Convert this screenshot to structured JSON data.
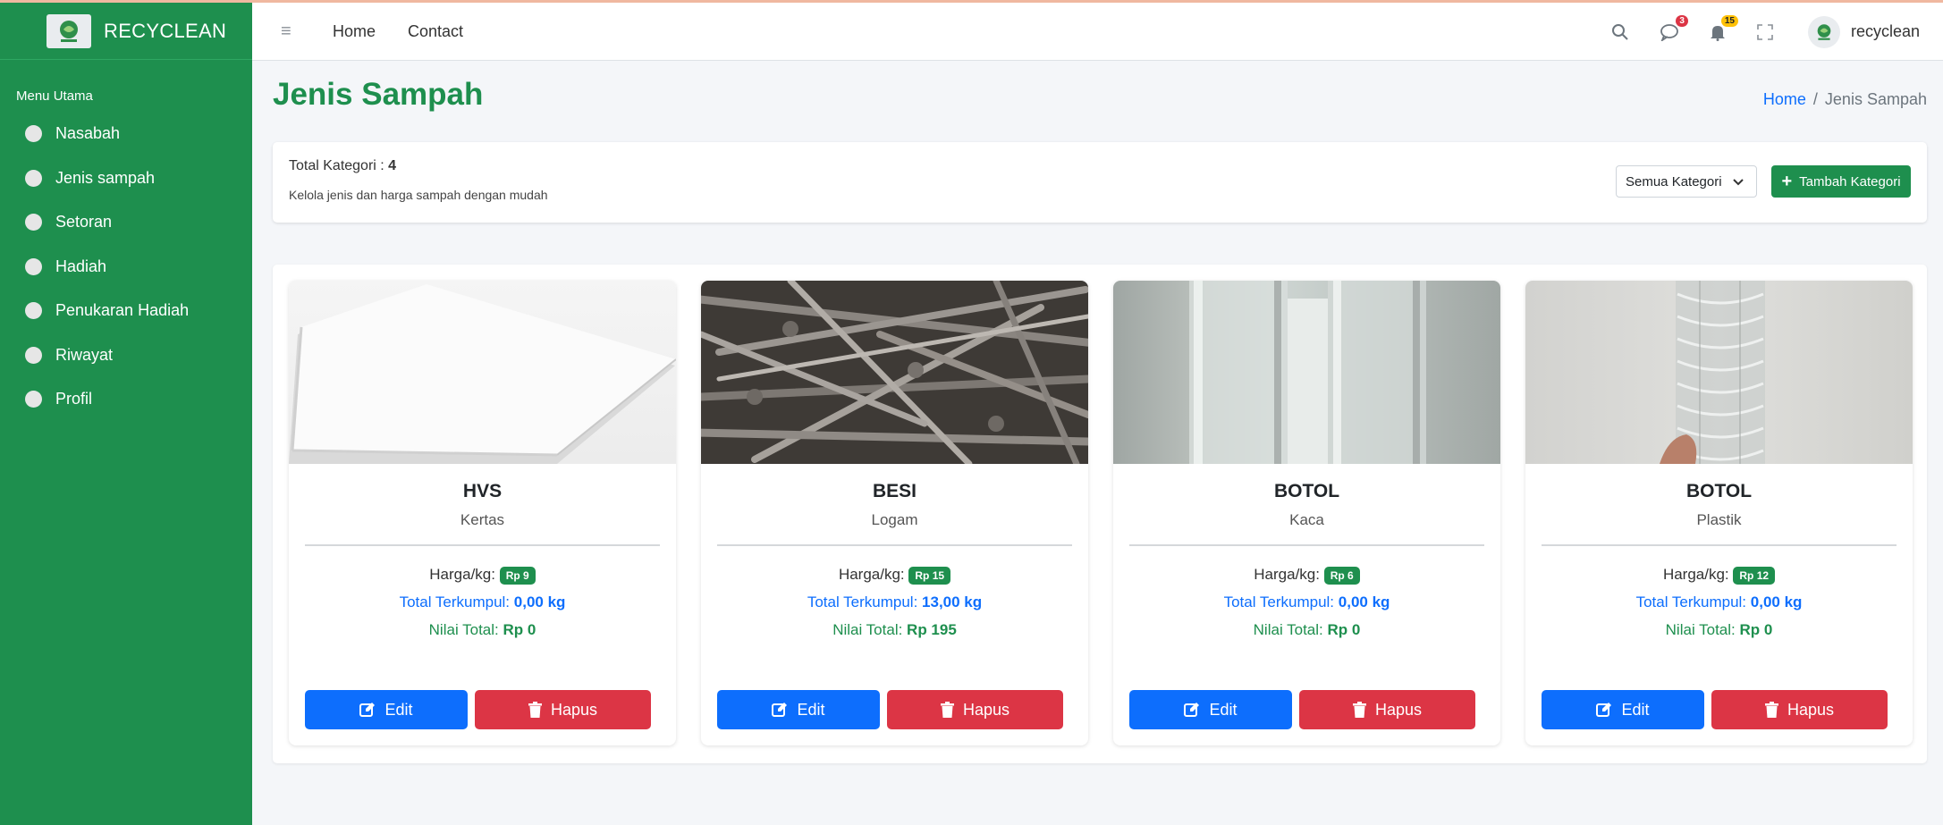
{
  "brand": {
    "name": "RECYCLEAN"
  },
  "sidebar": {
    "title": "Menu Utama",
    "items": [
      {
        "label": "Nasabah"
      },
      {
        "label": "Jenis sampah"
      },
      {
        "label": "Setoran"
      },
      {
        "label": "Hadiah"
      },
      {
        "label": "Penukaran Hadiah"
      },
      {
        "label": "Riwayat"
      },
      {
        "label": "Profil"
      }
    ]
  },
  "navbar": {
    "links": [
      "Home",
      "Contact"
    ],
    "messages_badge": "3",
    "notifications_badge": "15",
    "user_name": "recyclean"
  },
  "page": {
    "title": "Jenis Sampah",
    "breadcrumb": {
      "home": "Home",
      "separator": "/",
      "current": "Jenis Sampah"
    }
  },
  "summary": {
    "total_label": "Total Kategori : ",
    "total_value": "4",
    "subtitle": "Kelola jenis dan harga sampah dengan mudah",
    "filter_selected": "Semua Kategori",
    "add_button": "Tambah Kategori"
  },
  "labels": {
    "price": "Harga/kg: ",
    "total_collected": "Total Terkumpul: ",
    "total_value": "Nilai Total: ",
    "edit": "Edit",
    "delete": "Hapus"
  },
  "cards": [
    {
      "name": "HVS",
      "category": "Kertas",
      "price": "Rp 9",
      "collected": "0,00 kg",
      "value": "Rp 0"
    },
    {
      "name": "BESI",
      "category": "Logam",
      "price": "Rp 15",
      "collected": "13,00 kg",
      "value": "Rp 195"
    },
    {
      "name": "BOTOL",
      "category": "Kaca",
      "price": "Rp 6",
      "collected": "0,00 kg",
      "value": "Rp 0"
    },
    {
      "name": "BOTOL",
      "category": "Plastik",
      "price": "Rp 12",
      "collected": "0,00 kg",
      "value": "Rp 0"
    }
  ],
  "colors": {
    "primary_green": "#1e8f4e",
    "edit_blue": "#0d6efd",
    "delete_red": "#dc3545",
    "badge_yellow": "#ffc107"
  }
}
